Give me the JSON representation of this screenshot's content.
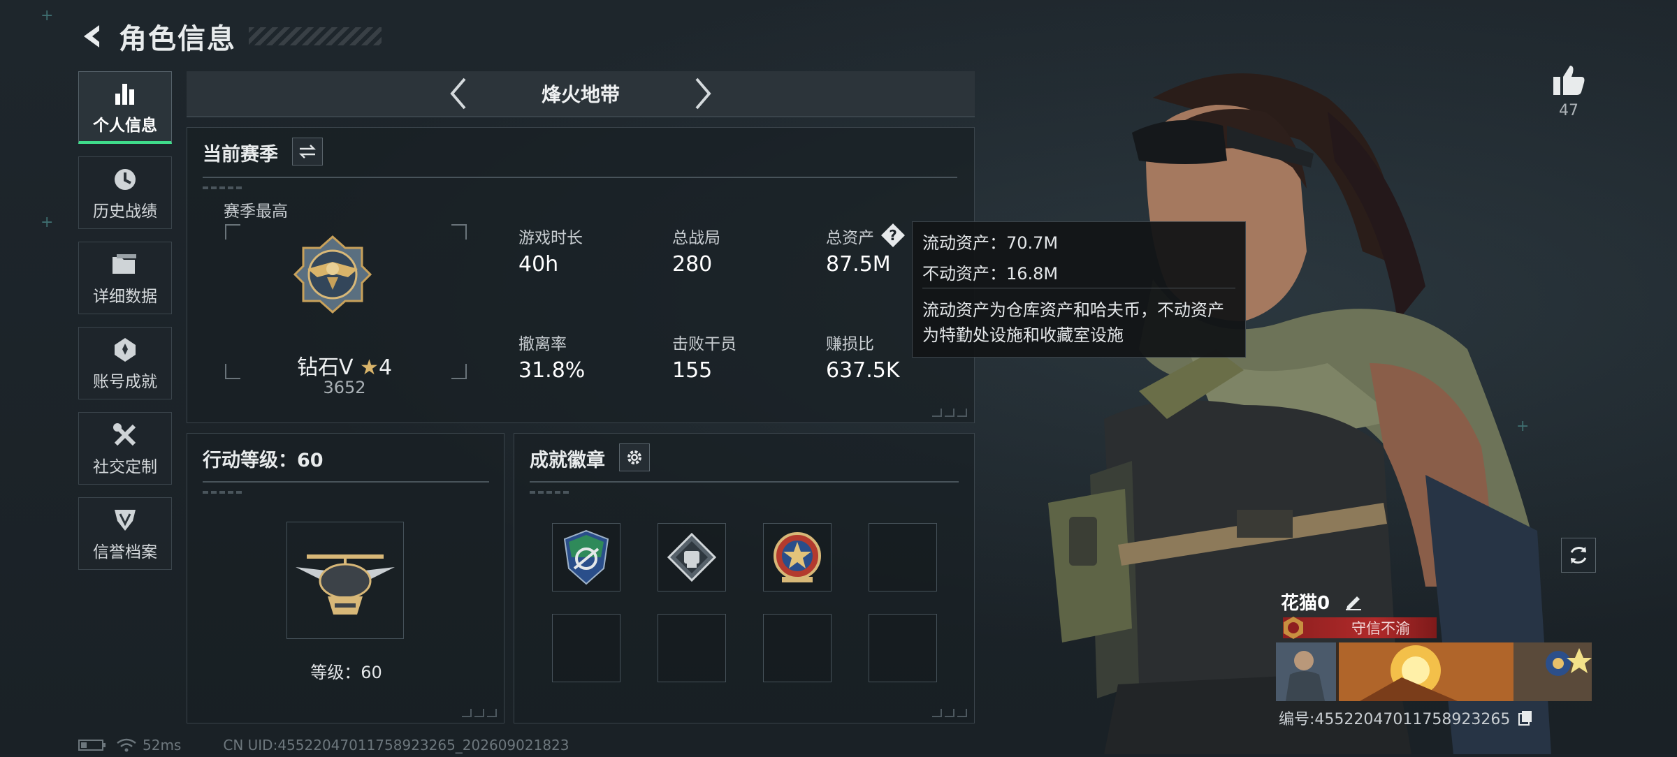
{
  "header": {
    "title": "角色信息"
  },
  "sidebar": {
    "items": [
      {
        "label": "个人信息",
        "icon": "bar-chart-icon",
        "active": true
      },
      {
        "label": "历史战绩",
        "icon": "history-icon"
      },
      {
        "label": "详细数据",
        "icon": "folder-icon"
      },
      {
        "label": "账号成就",
        "icon": "achievement-icon"
      },
      {
        "label": "社交定制",
        "icon": "tools-icon"
      },
      {
        "label": "信誉档案",
        "icon": "shield-icon"
      }
    ]
  },
  "mode": {
    "title": "烽火地带"
  },
  "season": {
    "title": "当前赛季",
    "best_label": "赛季最高",
    "rank_name": "钻石V",
    "rank_stars": "4",
    "rank_points": "3652",
    "stats": [
      {
        "label": "游戏时长",
        "value": "40h"
      },
      {
        "label": "总战局",
        "value": "280"
      },
      {
        "label": "总资产",
        "value": "87.5M"
      },
      {
        "label": "撤离率",
        "value": "31.8%"
      },
      {
        "label": "击败干员",
        "value": "155"
      },
      {
        "label": "赚损比",
        "value": "637.5K"
      }
    ]
  },
  "tooltip": {
    "liquid": "流动资产：70.7M",
    "fixed": "不动资产：16.8M",
    "desc_line1": "流动资产为仓库资产和哈夫币，不动资产",
    "desc_line2": "为特勤处设施和收藏室设施"
  },
  "action_level": {
    "title": "行动等级：60",
    "level_label": "等级：60"
  },
  "achievements": {
    "title": "成就徽章"
  },
  "like": {
    "count": "47"
  },
  "player": {
    "name": "花猫0",
    "title": "守信不渝",
    "id_label": "编号:45522047011758923265"
  },
  "footer": {
    "ping": "52ms",
    "uid": "CN UID:45522047011758923265_202609021823"
  },
  "colors": {
    "accent": "#3fdc8b",
    "tooltip_bg": "#121416",
    "title_red": "#b02a2a"
  }
}
